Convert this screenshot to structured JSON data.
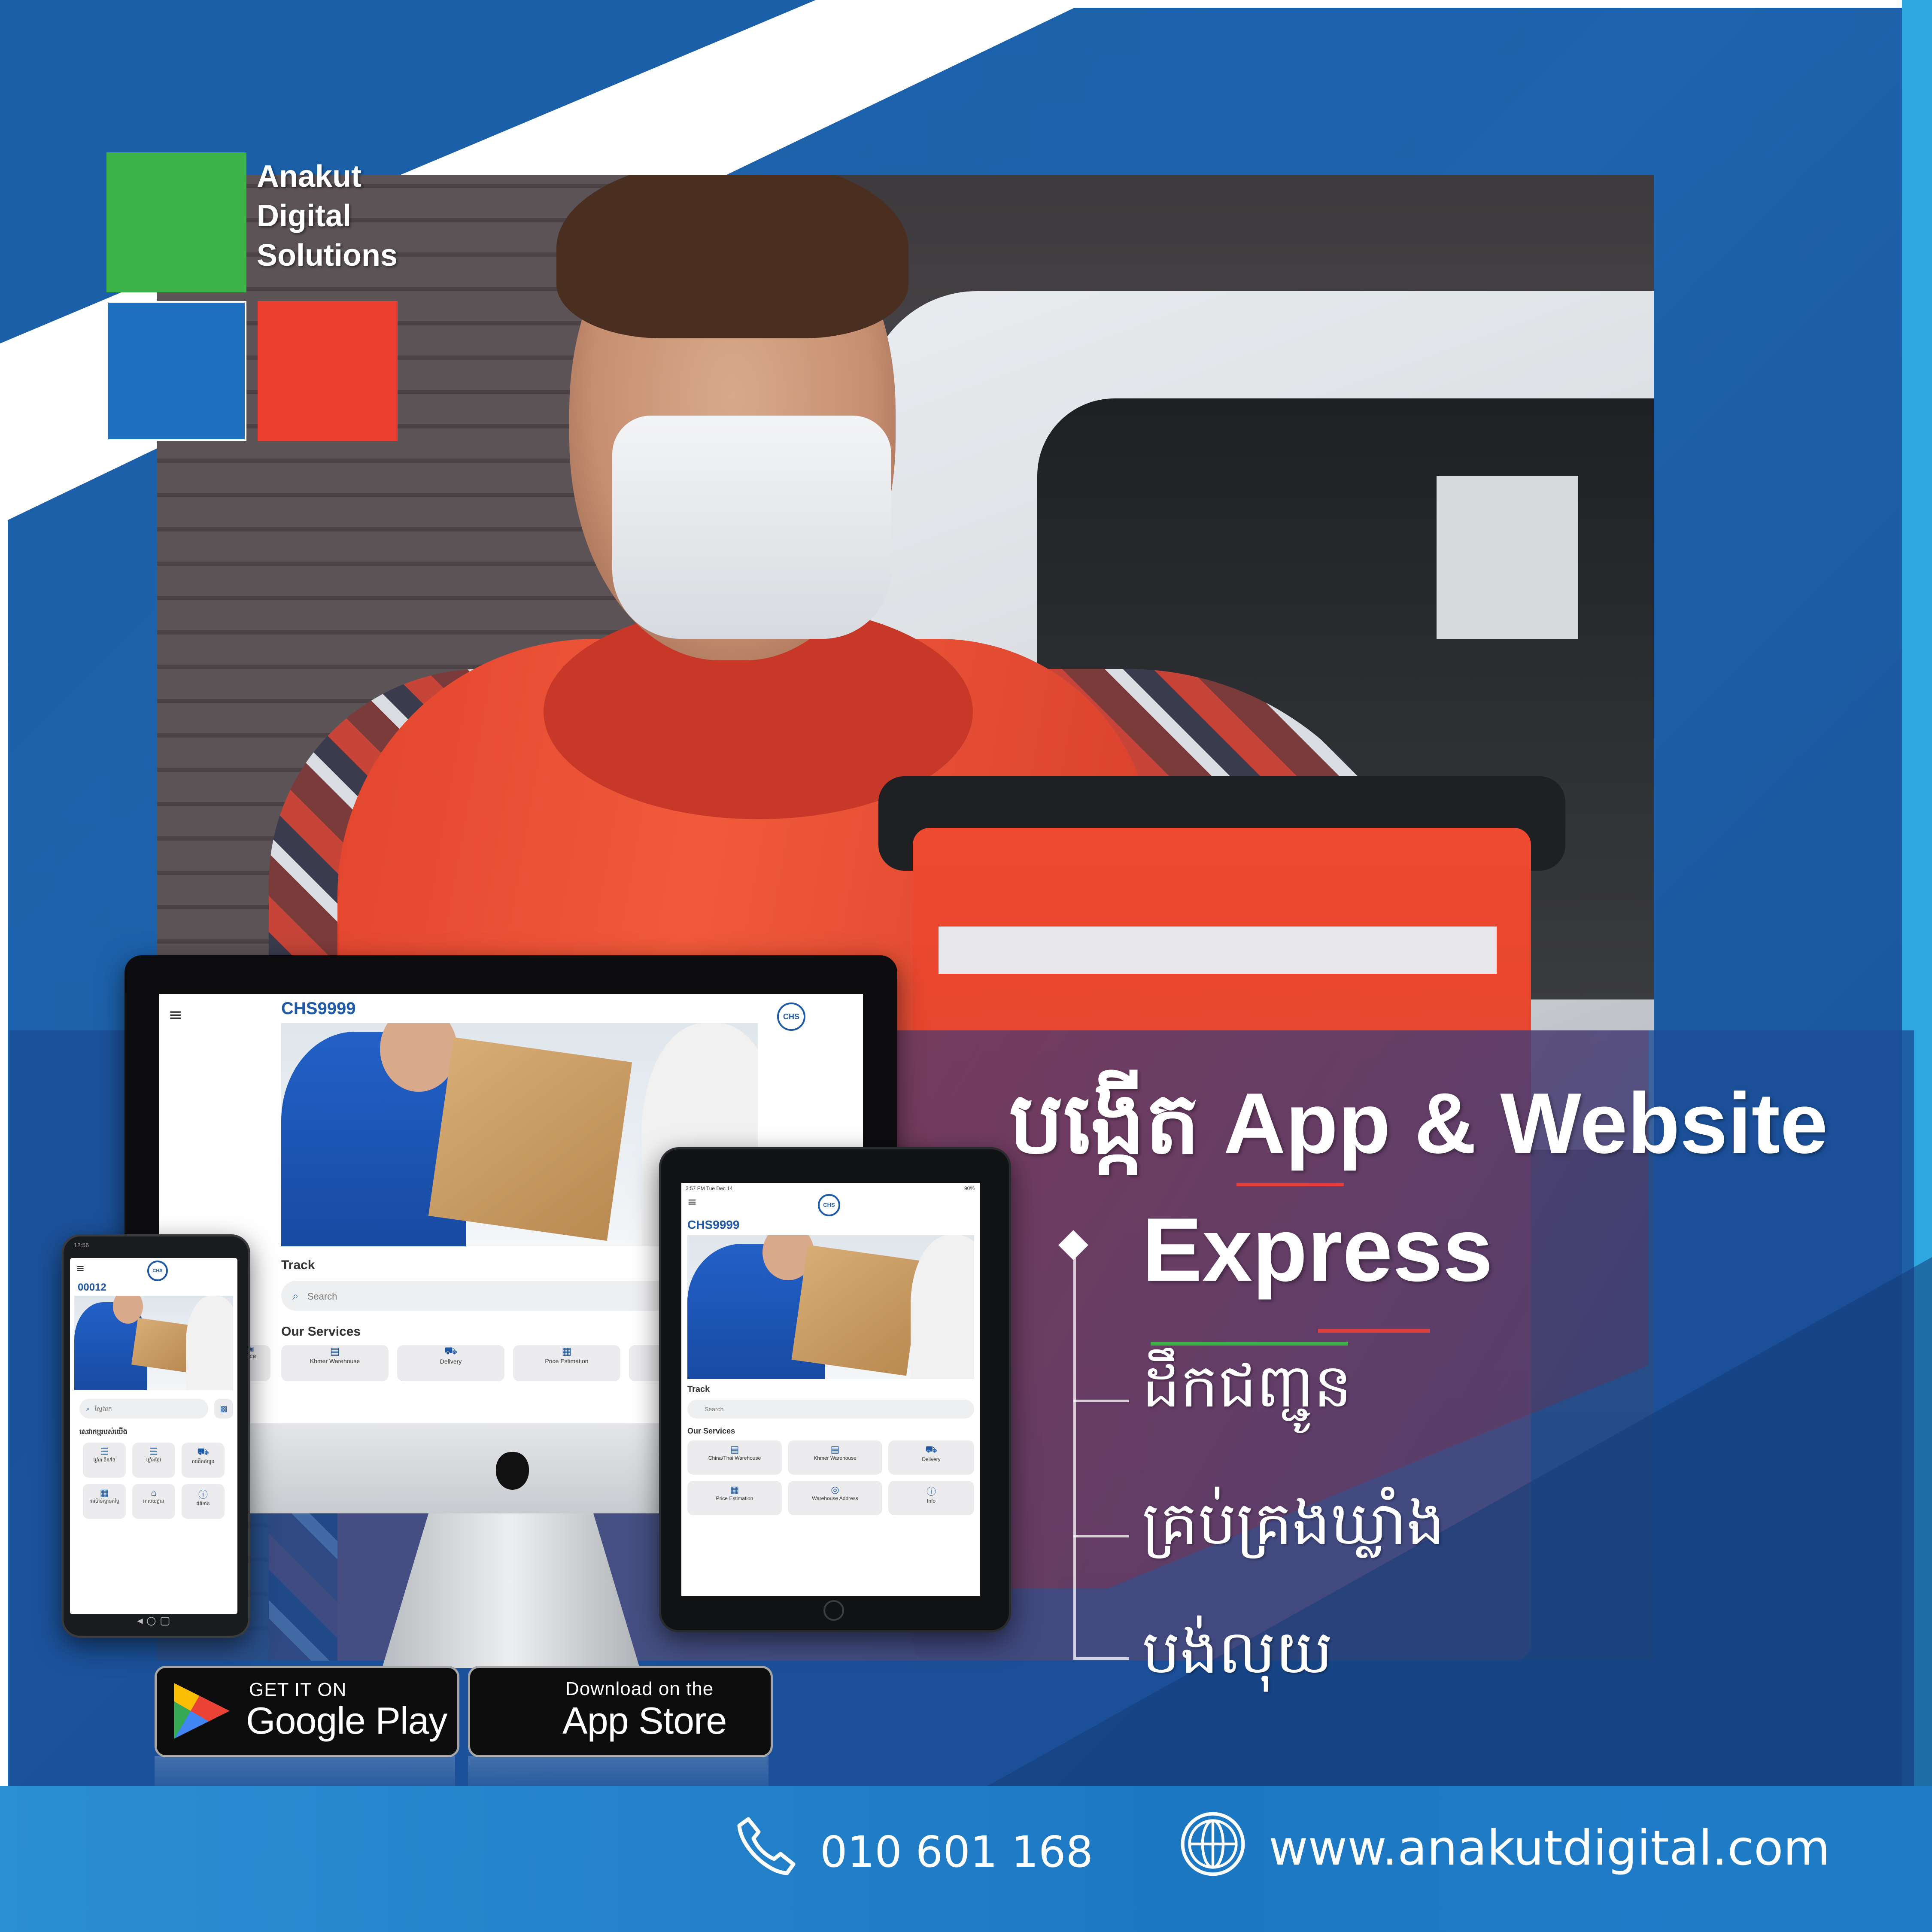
{
  "brand": {
    "logo_text_line1": "Anakut",
    "logo_text_line2": "Digital",
    "logo_text_line3": "Solutions",
    "colors": {
      "green": "#3db34a",
      "blue": "#1e6fc0",
      "red": "#ee3f33",
      "background_blue": "#1b5fa8"
    }
  },
  "headline": {
    "line1": "បង្កើត App & Website",
    "line2": "Express"
  },
  "features": [
    {
      "label": "ដឹកជញ្ជូន"
    },
    {
      "label": "គ្រប់គ្រងឃ្លាំង"
    },
    {
      "label": "បង់លុយ"
    }
  ],
  "desktop_app": {
    "title": "CHS9999",
    "logo": "CHS",
    "track_label": "Track",
    "search_placeholder": "Search",
    "services_heading": "Our Services",
    "services": [
      "ace",
      "Khmer Warehouse",
      "Delivery",
      "Price Estimation",
      "W"
    ]
  },
  "tablet_app": {
    "status_time": "3:57 PM  Tue Dec 14",
    "status_battery": "90%",
    "title": "CHS9999",
    "logo": "CHS",
    "track_label": "Track",
    "search_placeholder": "Search",
    "services_heading": "Our Services",
    "services": [
      "China/Thai Warehouse",
      "Khmer Warehouse",
      "Delivery",
      "Price Estimation",
      "Warehouse Address",
      "Info"
    ]
  },
  "phone_app": {
    "status_time": "12:56",
    "title": "00012",
    "logo": "CHS",
    "search_placeholder": "ស្វែងរក",
    "services_heading": "សេវាកម្មរបស់យើង",
    "services": [
      "ឃ្លាំង ចិន/ថៃ",
      "ឃ្លាំងខ្មែរ",
      "ការដឹកជញ្ជូន",
      "ការប៉ាន់ស្មានតម្លៃ",
      "អាសយដ្ឋាន",
      "ព័ត៌មាន"
    ],
    "nav": "◂   ○   ▢"
  },
  "store_badges": {
    "google_small": "GET IT ON",
    "google_big": "Google Play",
    "apple_small": "Download on the",
    "apple_big": "App Store"
  },
  "contact": {
    "phone": "010 601 168",
    "website": "www.anakutdigital.com"
  },
  "icons": [
    "phone-icon",
    "globe-icon",
    "apple-icon",
    "google-play-icon",
    "menu-icon",
    "search-icon"
  ]
}
